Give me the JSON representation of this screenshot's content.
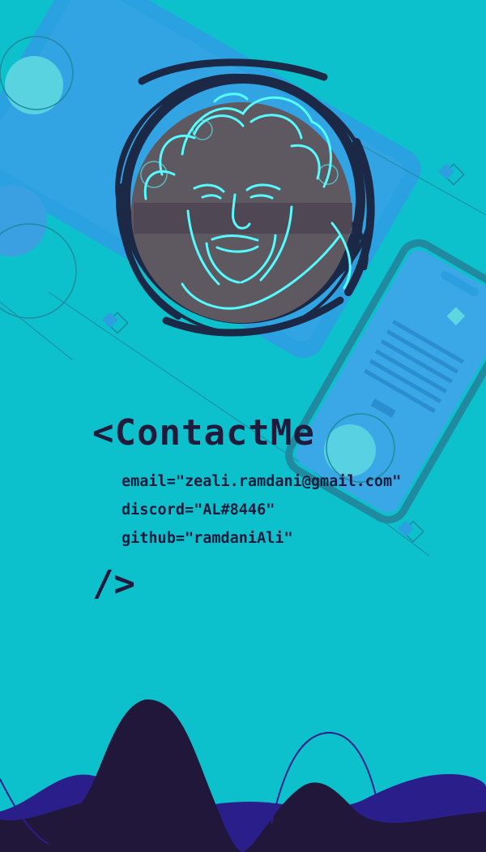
{
  "card": {
    "tag_open": "<ContactMe",
    "tag_close": "/>",
    "attributes": [
      "email=\"zeali.ramdani@gmail.com\"",
      "discord=\"AL#8446\"",
      "github=\"ramdaniAli\""
    ]
  },
  "colors": {
    "background": "#0cc0cc",
    "text": "#201a3c",
    "device_blue": "#2c9fe0",
    "wave_dark": "#21173a",
    "wave_purple": "#2a1e8a",
    "portrait_glow": "#56fbff"
  },
  "icons": {
    "portrait": "portrait-illustration",
    "phone": "smartphone-icon",
    "tablet": "tablet-icon"
  }
}
